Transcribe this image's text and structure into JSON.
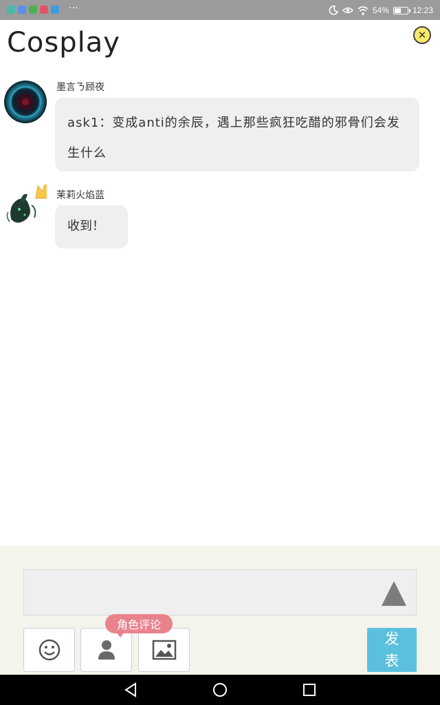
{
  "status_bar": {
    "app_icons": [
      {
        "name": "app-icon-1",
        "color": "#4ab8a8"
      },
      {
        "name": "app-icon-2",
        "color": "#5a8ee8"
      },
      {
        "name": "app-icon-3",
        "color": "#4caf50"
      },
      {
        "name": "app-icon-4",
        "color": "#e05561"
      },
      {
        "name": "app-icon-5",
        "color": "#3d9be0"
      }
    ],
    "more": "···",
    "battery_percent": "54%",
    "battery_level": 0.54,
    "time": "12:23"
  },
  "header": {
    "title": "Cosplay"
  },
  "messages": [
    {
      "username": "墨言ㄋ顾夜",
      "text": "ask1：变成anti的余辰，遇上那些疯狂吃醋的邪骨们会发生什么"
    },
    {
      "username": "茉莉火焰蓝",
      "text": "收到！"
    }
  ],
  "compose": {
    "input_value": "",
    "role_comment_tag": "角色评论",
    "post_label": "发表"
  },
  "colors": {
    "close_bg": "#f7e96a",
    "bubble_bg": "#efefef",
    "compose_bg": "#f4f3ec",
    "tag_bg": "#e9828d",
    "post_bg": "#5bc0de"
  }
}
